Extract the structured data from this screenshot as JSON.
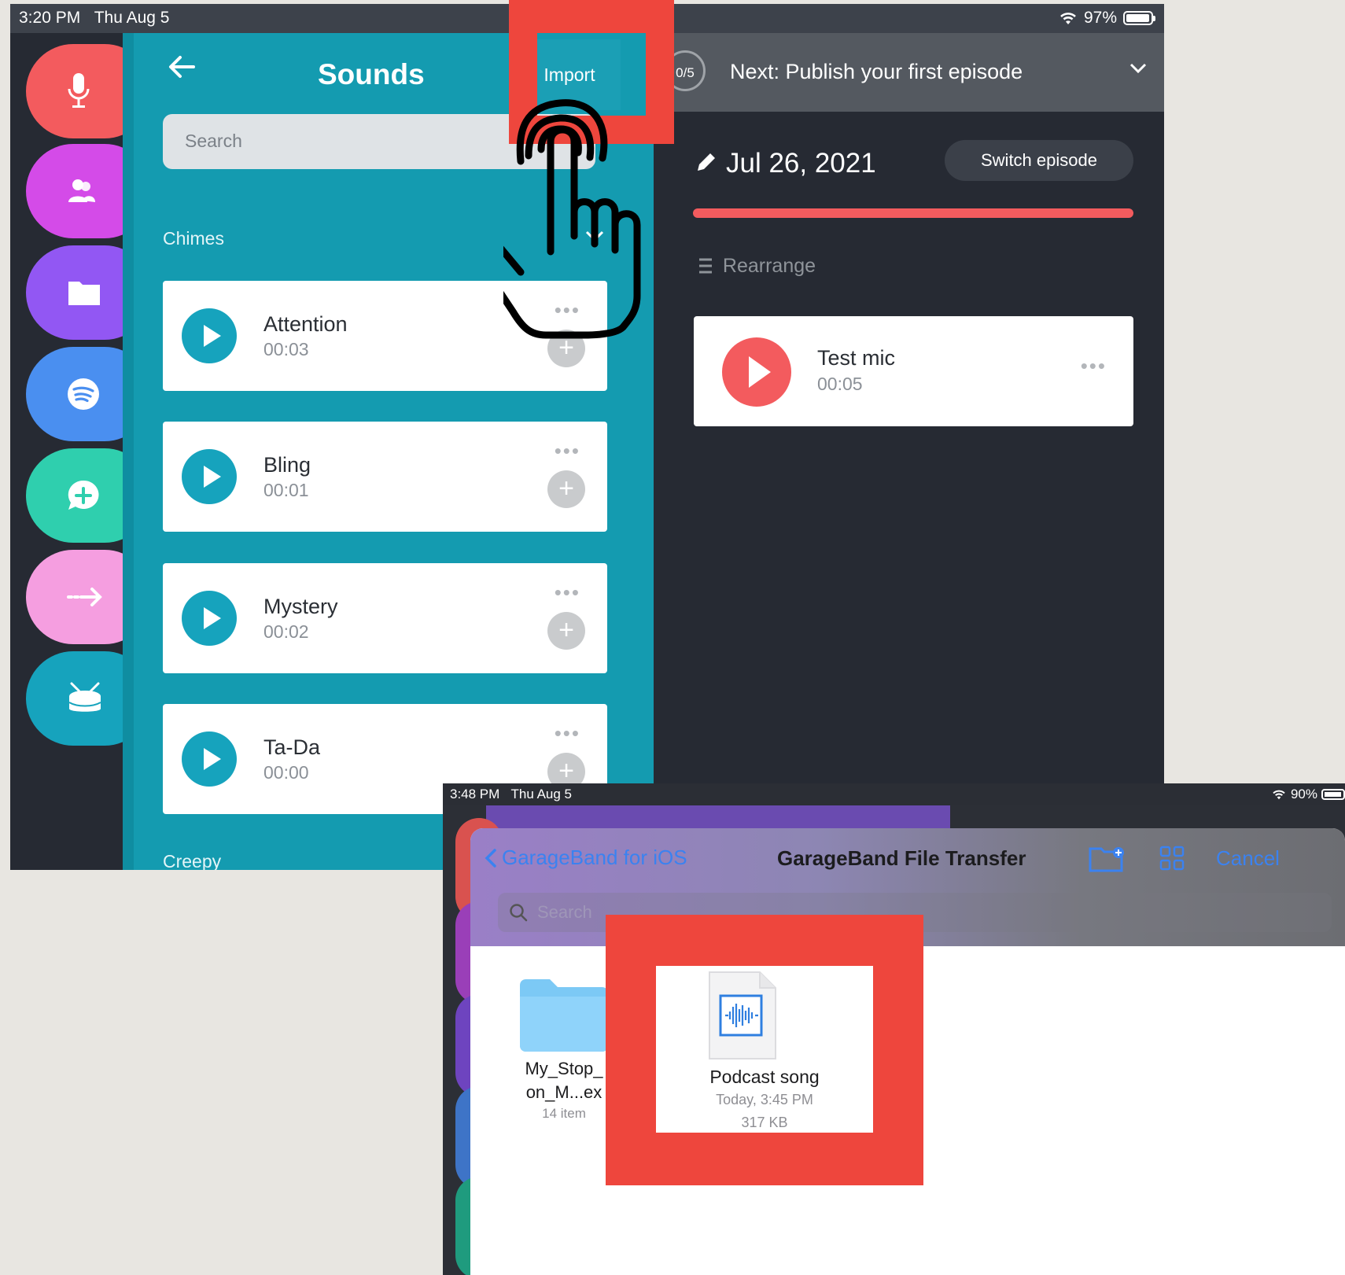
{
  "screen1": {
    "status": {
      "time": "3:20 PM",
      "date": "Thu Aug 5",
      "battery": "97%",
      "battery_level": 0.97
    },
    "rail_icons": [
      {
        "icon": "microphone-icon",
        "color": "#f35b5e"
      },
      {
        "icon": "people-icon",
        "color": "#d44be8"
      },
      {
        "icon": "folder-icon",
        "color": "#9257f3"
      },
      {
        "icon": "spotify-icon",
        "color": "#4a8ff0"
      },
      {
        "icon": "chat-plus-icon",
        "color": "#2fcfae"
      },
      {
        "icon": "transition-arrow-icon",
        "color": "#f59ee0"
      },
      {
        "icon": "drum-icon",
        "color": "#16a3bd"
      }
    ],
    "sounds": {
      "title": "Sounds",
      "import_label": "Import",
      "search_placeholder": "Search",
      "section_chimes": "Chimes",
      "section_creepy": "Creepy",
      "items": [
        {
          "name": "Attention",
          "duration": "00:03"
        },
        {
          "name": "Bling",
          "duration": "00:01"
        },
        {
          "name": "Mystery",
          "duration": "00:02"
        },
        {
          "name": "Ta-Da",
          "duration": "00:00"
        }
      ],
      "more_glyph": "•••",
      "add_glyph": "+"
    },
    "episode": {
      "progress": "0/5",
      "next_label": "Next: Publish your first episode",
      "date": "Jul 26, 2021",
      "switch_label": "Switch episode",
      "rearrange_label": "Rearrange",
      "segment": {
        "name": "Test mic",
        "duration": "00:05"
      }
    },
    "accent": "#149bb0",
    "highlight_color": "#ee463d"
  },
  "screen2": {
    "status": {
      "time": "3:48 PM",
      "date": "Thu Aug 5",
      "battery": "90%",
      "battery_level": 0.9
    },
    "back_label": "GarageBand for iOS",
    "title": "GarageBand File Transfer",
    "cancel_label": "Cancel",
    "search_placeholder": "Search",
    "folder": {
      "name_line1": "My_Stop_",
      "name_line2": "on_M...ex",
      "meta": "14 item"
    },
    "file": {
      "name": "Podcast song",
      "date": "Today, 3:45 PM",
      "size": "317 KB"
    }
  }
}
